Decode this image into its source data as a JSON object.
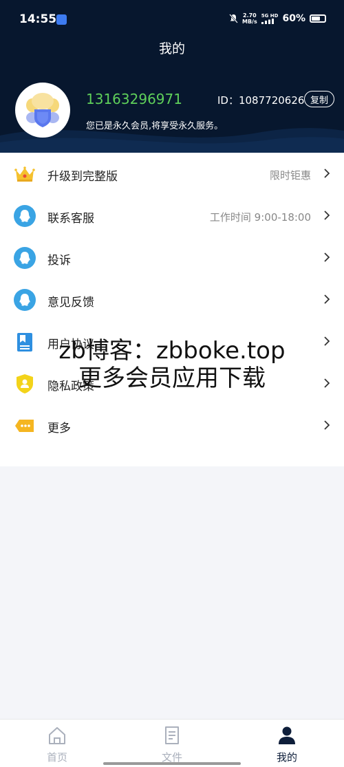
{
  "status_bar": {
    "time": "14:55",
    "speed_value": "2.70",
    "speed_unit": "MB/s",
    "network": "5G HD",
    "battery": "60%"
  },
  "header": {
    "title": "我的",
    "phone": "13163296971",
    "id_label": "ID：1087720626",
    "copy_label": "复制",
    "member_text": "您已是永久会员,将享受永久服务。"
  },
  "menu": {
    "items": [
      {
        "label": "升级到完整版",
        "right": "限时钜惠",
        "icon": "crown-icon"
      },
      {
        "label": "联系客服",
        "right": "工作时间 9:00-18:00",
        "icon": "qq-icon"
      },
      {
        "label": "投诉",
        "right": "",
        "icon": "qq-icon"
      },
      {
        "label": "意见反馈",
        "right": "",
        "icon": "qq-icon"
      },
      {
        "label": "用户协议",
        "right": "",
        "icon": "document-icon"
      },
      {
        "label": "隐私政策",
        "right": "",
        "icon": "shield-icon"
      },
      {
        "label": "更多",
        "right": "",
        "icon": "tag-icon"
      }
    ]
  },
  "watermark": {
    "line1": "zb博客：zbboke.top",
    "line2": "更多会员应用下载"
  },
  "tabbar": {
    "tabs": [
      {
        "label": "首页",
        "icon": "home-icon"
      },
      {
        "label": "文件",
        "icon": "file-icon"
      },
      {
        "label": "我的",
        "icon": "user-icon",
        "active": true
      }
    ]
  },
  "colors": {
    "header_bg": "#07172e",
    "phone_green": "#5fd05a",
    "crown_yellow": "#f5c12e",
    "qq_blue": "#3aa4e4"
  }
}
